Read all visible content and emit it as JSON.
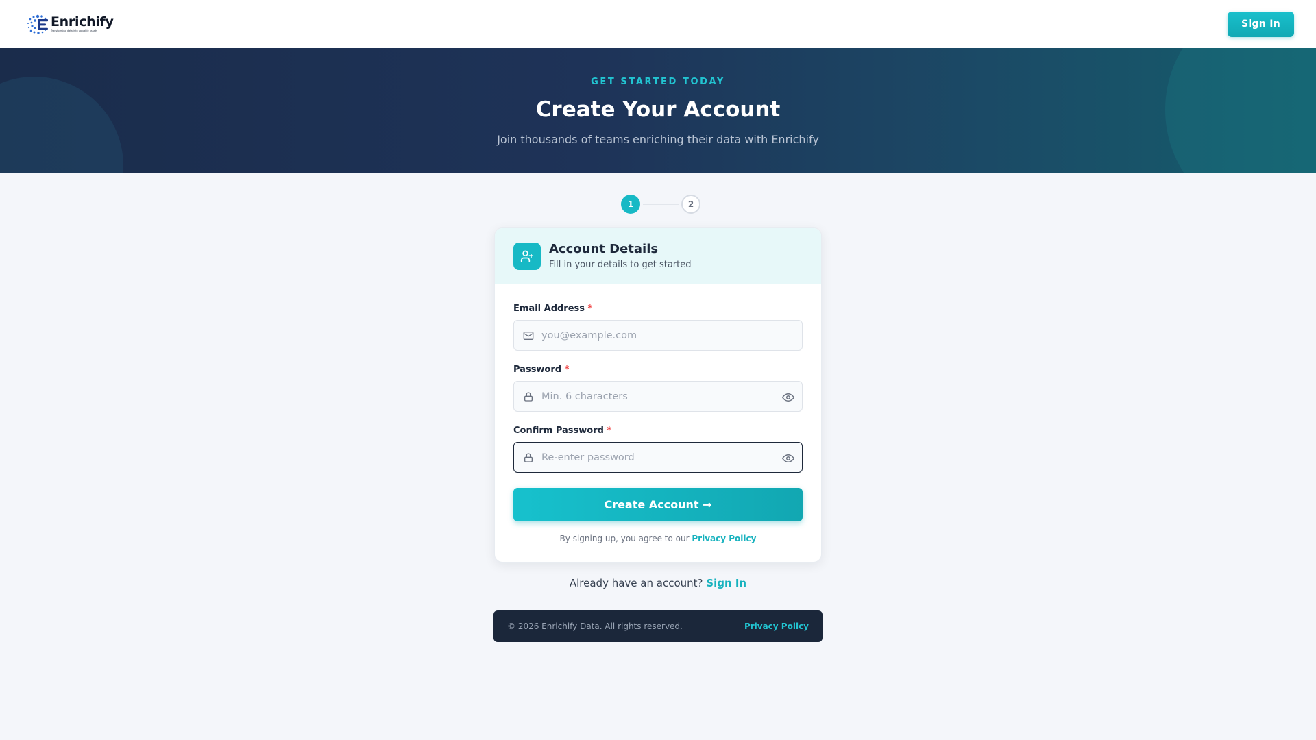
{
  "header": {
    "logo_text": "Enrichify",
    "logo_tagline": "Transforming data into valuable assets",
    "signin_label": "Sign In"
  },
  "hero": {
    "eyebrow": "GET STARTED TODAY",
    "title": "Create Your Account",
    "subtitle": "Join thousands of teams enriching their data with Enrichify"
  },
  "stepper": {
    "steps": [
      "1",
      "2"
    ],
    "active_step": 1
  },
  "card": {
    "title": "Account Details",
    "subtitle": "Fill in your details to get started",
    "fields": [
      {
        "label": "Email Address",
        "required_mark": "*",
        "placeholder": "you@example.com",
        "value": ""
      },
      {
        "label": "Password",
        "required_mark": "*",
        "placeholder": "Min. 6 characters",
        "value": ""
      },
      {
        "label": "Confirm Password",
        "required_mark": "*",
        "placeholder": "Re-enter password",
        "value": ""
      }
    ],
    "submit_label": "Create Account →",
    "terms_text": "By signing up, you agree to our ",
    "terms_link": "Privacy Policy"
  },
  "signin_prompt": {
    "text": "Already have an account? ",
    "link": "Sign In"
  },
  "footer": {
    "copyright": "© 2026 Enrichify Data. All rights reserved.",
    "link": "Privacy Policy"
  },
  "colors": {
    "accent": "#17b9c5",
    "hero_start": "#1a2c4b",
    "hero_end": "#145e6c",
    "footer_bg": "#1b273a",
    "required": "#ef4444"
  },
  "icons": [
    "logo-mark-icon",
    "user-plus-icon",
    "mail-icon",
    "lock-icon",
    "eye-icon"
  ]
}
